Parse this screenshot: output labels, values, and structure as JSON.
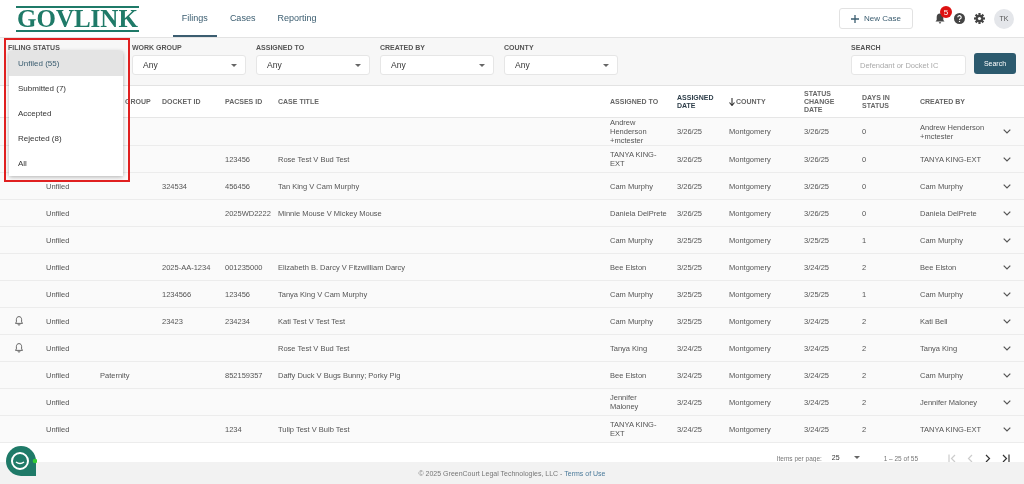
{
  "header": {
    "logo": "GOVLINK",
    "nav": [
      {
        "label": "Filings",
        "selected": true
      },
      {
        "label": "Cases",
        "selected": false
      },
      {
        "label": "Reporting",
        "selected": false
      }
    ],
    "new_case": "New Case",
    "notification_count": "5",
    "avatar": "TK"
  },
  "filters": [
    {
      "label": "FILING STATUS"
    },
    {
      "label": "WORK GROUP",
      "value": "Any"
    },
    {
      "label": "ASSIGNED TO",
      "value": "Any"
    },
    {
      "label": "CREATED BY",
      "value": "Any"
    },
    {
      "label": "COUNTY",
      "value": "Any"
    }
  ],
  "search": {
    "label": "SEARCH",
    "placeholder": "Defendant or Docket IC",
    "button": "Search"
  },
  "dropdown": {
    "options": [
      {
        "label": "Unfiled (55)",
        "selected": true
      },
      {
        "label": "Submitted (7)",
        "selected": false
      },
      {
        "label": "Accepted",
        "selected": false
      },
      {
        "label": "Rejected (8)",
        "selected": false
      },
      {
        "label": "All",
        "selected": false
      }
    ]
  },
  "table": {
    "columns": [
      {},
      {
        "label": "GROUP",
        "active": false
      },
      {
        "label": "DOCKET ID",
        "active": false
      },
      {
        "label": "PACSES ID",
        "active": false
      },
      {
        "label": "CASE TITLE",
        "active": false
      },
      {
        "label": "ASSIGNED TO",
        "active": false
      },
      {
        "label": "ASSIGNED DATE",
        "active": true
      },
      {
        "label": "COUNTY",
        "active": false,
        "sort_arrow": true
      },
      {
        "label": "STATUS CHANGE DATE",
        "active": false
      },
      {
        "label": "DAYS IN STATUS",
        "active": false
      },
      {
        "label": "CREATED BY",
        "active": false
      }
    ],
    "rows": [
      {
        "reminder": false,
        "cells": [
          "",
          "",
          "",
          "",
          "",
          "Andrew Henderson +mctester",
          "3/26/25",
          "Montgomery",
          "3/26/25",
          "0",
          "Andrew Henderson +mctester"
        ]
      },
      {
        "reminder": false,
        "cells": [
          "",
          "",
          "",
          "123456",
          "Rose Test V Bud Test",
          "TANYA KING-EXT",
          "3/26/25",
          "Montgomery",
          "3/26/25",
          "0",
          "TANYA KING-EXT"
        ]
      },
      {
        "reminder": false,
        "cells": [
          "Unfiled",
          "",
          "324534",
          "456456",
          "Tan King V Cam Murphy",
          "Cam Murphy",
          "3/26/25",
          "Montgomery",
          "3/26/25",
          "0",
          "Cam Murphy"
        ]
      },
      {
        "reminder": false,
        "cells": [
          "Unfiled",
          "",
          "",
          "2025WD2222",
          "Minnie Mouse V Mickey Mouse",
          "Daniela DelPrete",
          "3/26/25",
          "Montgomery",
          "3/26/25",
          "0",
          "Daniela DelPrete"
        ]
      },
      {
        "reminder": false,
        "cells": [
          "Unfiled",
          "",
          "",
          "",
          "",
          "Cam Murphy",
          "3/25/25",
          "Montgomery",
          "3/25/25",
          "1",
          "Cam Murphy"
        ]
      },
      {
        "reminder": false,
        "cells": [
          "Unfiled",
          "",
          "2025-AA-1234",
          "001235000",
          "Elizabeth B. Darcy V Fitzwilliam Darcy",
          "Bee Elston",
          "3/25/25",
          "Montgomery",
          "3/24/25",
          "2",
          "Bee Elston"
        ]
      },
      {
        "reminder": false,
        "cells": [
          "Unfiled",
          "",
          "1234566",
          "123456",
          "Tanya King V Cam Murphy",
          "Cam Murphy",
          "3/25/25",
          "Montgomery",
          "3/25/25",
          "1",
          "Cam Murphy"
        ]
      },
      {
        "reminder": true,
        "cells": [
          "Unfiled",
          "",
          "23423",
          "234234",
          "Kati Test V Test Test",
          "Cam Murphy",
          "3/25/25",
          "Montgomery",
          "3/24/25",
          "2",
          "Kati Bell"
        ]
      },
      {
        "reminder": true,
        "cells": [
          "Unfiled",
          "",
          "",
          "",
          "Rose Test V Bud Test",
          "Tanya King",
          "3/24/25",
          "Montgomery",
          "3/24/25",
          "2",
          "Tanya King"
        ]
      },
      {
        "reminder": false,
        "cells": [
          "Unfiled",
          "Paternity",
          "",
          "852159357",
          "Daffy Duck V Bugs Bunny; Porky Pig",
          "Bee Elston",
          "3/24/25",
          "Montgomery",
          "3/24/25",
          "2",
          "Cam Murphy"
        ]
      },
      {
        "reminder": false,
        "cells": [
          "Unfiled",
          "",
          "",
          "",
          "",
          "Jennifer Maloney",
          "3/24/25",
          "Montgomery",
          "3/24/25",
          "2",
          "Jennifer Maloney"
        ]
      },
      {
        "reminder": false,
        "cells": [
          "Unfiled",
          "",
          "",
          "1234",
          "Tulip Test V Bulb Test",
          "TANYA KING-EXT",
          "3/24/25",
          "Montgomery",
          "3/24/25",
          "2",
          "TANYA KING-EXT"
        ]
      }
    ]
  },
  "pagination": {
    "label": "Items per page:",
    "page_size": "25",
    "range": "1 – 25 of 55",
    "first_disabled": true,
    "prev_disabled": true,
    "next_disabled": false,
    "last_disabled": false
  },
  "footer": {
    "text": "© 2025 GreenCourt Legal Technologies, LLC - ",
    "link": "Terms of Use"
  }
}
